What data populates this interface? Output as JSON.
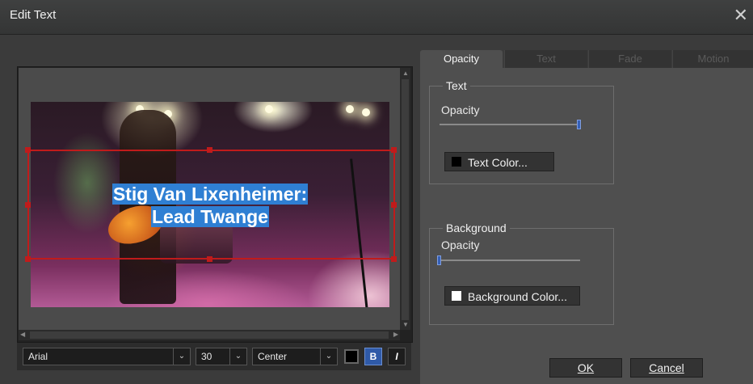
{
  "window": {
    "title": "Edit Text",
    "close_glyph": "✕"
  },
  "preview": {
    "caption_line1": "Stig Van Lixenheimer:",
    "caption_line2": "Lead Twange"
  },
  "toolbar": {
    "font": "Arial",
    "size": "30",
    "alignment": "Center",
    "color_swatch": "#000000",
    "bold_label": "B",
    "italic_label": "I",
    "bold_active": true
  },
  "tabs": [
    {
      "label": "Opacity",
      "active": true
    },
    {
      "label": "Text",
      "active": false
    },
    {
      "label": "Fade",
      "active": false
    },
    {
      "label": "Motion",
      "active": false
    }
  ],
  "opacity_panel": {
    "text_group": {
      "legend": "Text",
      "opacity_label": "Opacity",
      "opacity_value": 1.0,
      "color_button": "Text Color...",
      "color": "#000000"
    },
    "background_group": {
      "legend": "Background",
      "opacity_label": "Opacity",
      "opacity_value": 0.0,
      "color_button": "Background Color...",
      "color": "#ffffff"
    }
  },
  "buttons": {
    "ok": "OK",
    "cancel": "Cancel"
  },
  "icons": {
    "dropdown": "chevron-down-icon",
    "close": "close-icon"
  },
  "colors": {
    "accent": "#3560b8",
    "selection": "#c01b1b",
    "text_highlight": "#2f7fd3"
  }
}
